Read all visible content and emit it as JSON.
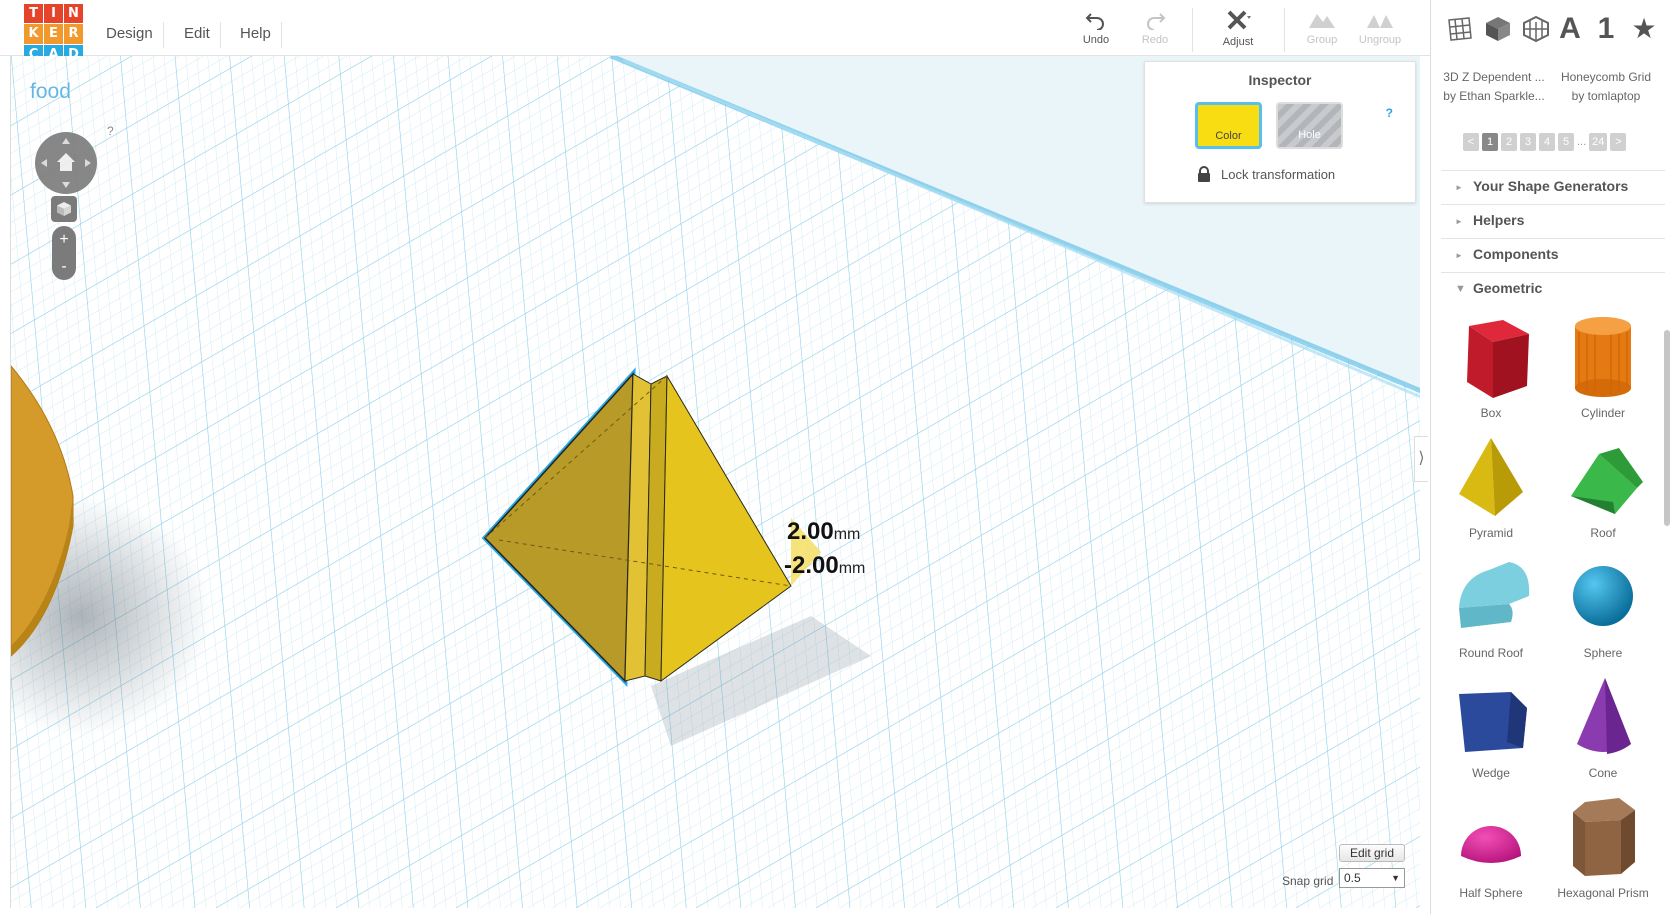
{
  "logo": {
    "letters": [
      "T",
      "I",
      "N",
      "K",
      "E",
      "R",
      "C",
      "A",
      "D"
    ],
    "colors": [
      "#e5442b",
      "#e5442b",
      "#e5442b",
      "#f2992e",
      "#f2992e",
      "#f2992e",
      "#27a9e1",
      "#27a9e1",
      "#27a9e1"
    ]
  },
  "menu": {
    "items": [
      "Design",
      "Edit",
      "Help"
    ]
  },
  "toolbar": {
    "undo": "Undo",
    "redo": "Redo",
    "adjust": "Adjust",
    "group": "Group",
    "ungroup": "Ungroup"
  },
  "design": {
    "name": "food"
  },
  "navigation": {
    "help": "?",
    "zoom_in": "+",
    "zoom_out": "-"
  },
  "inspector": {
    "title": "Inspector",
    "color_label": "Color",
    "hole_label": "Hole",
    "help": "?",
    "lock_label": "Lock transformation",
    "color_value": "#f7dd11"
  },
  "dimensions": [
    {
      "value": "2.00",
      "unit": "mm"
    },
    {
      "value": "-2.00",
      "unit": "mm"
    }
  ],
  "grid": {
    "edit_label": "Edit grid",
    "snap_label": "Snap grid",
    "snap_value": "0.5"
  },
  "panel": {
    "top_icons": [
      "grid-icon",
      "cube-icon",
      "honeycomb-icon",
      "letter-a-icon",
      "number-one-icon",
      "star-icon"
    ],
    "top_text": {
      "letter": "A",
      "number": "1",
      "star": "★"
    },
    "generators": [
      {
        "title": "3D Z Dependent ...",
        "author": "by Ethan Sparkle..."
      },
      {
        "title": "Honeycomb Grid",
        "author": "by tomlaptop"
      }
    ],
    "pages": [
      "<",
      "1",
      "2",
      "3",
      "4",
      "5",
      "...",
      "24",
      ">"
    ],
    "sections": [
      {
        "label": "Your Shape Generators",
        "expanded": false
      },
      {
        "label": "Helpers",
        "expanded": false
      },
      {
        "label": "Components",
        "expanded": false
      },
      {
        "label": "Geometric",
        "expanded": true
      }
    ],
    "shapes": [
      "Box",
      "Cylinder",
      "Pyramid",
      "Roof",
      "Round Roof",
      "Sphere",
      "Wedge",
      "Cone",
      "Half Sphere",
      "Hexagonal Prism"
    ]
  }
}
